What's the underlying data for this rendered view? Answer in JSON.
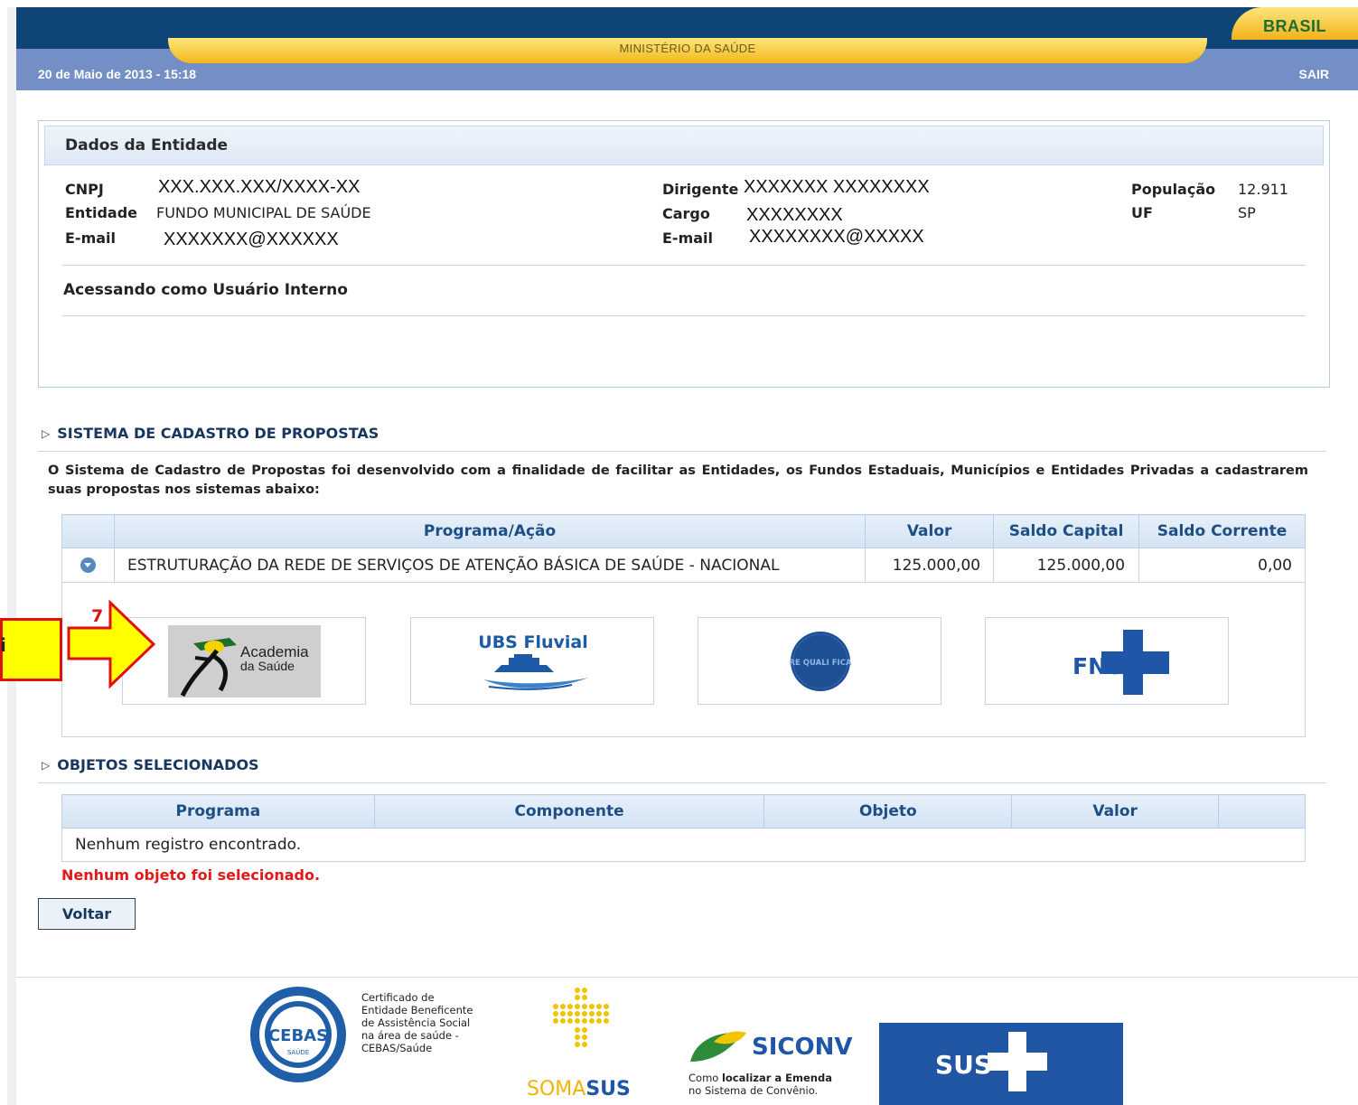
{
  "header": {
    "ministry": "MINISTÉRIO DA SAÚDE",
    "brasil": "BRASIL",
    "date": "20 de Maio de 2013   - 15:18",
    "logout": "SAIR"
  },
  "entity": {
    "title": "Dados da Entidade",
    "cnpj_label": "CNPJ",
    "cnpj": "XXX.XXX.XXX/XXXX-XX",
    "entidade_label": "Entidade",
    "entidade": "FUNDO MUNICIPAL DE SAÚDE",
    "email_label": "E-mail",
    "email": "XXXXXXX@XXXXXX",
    "dirigente_label": "Dirigente",
    "dirigente": "XXXXXXX XXXXXXXX",
    "cargo_label": "Cargo",
    "cargo": "XXXXXXXX",
    "email2_label": "E-mail",
    "email2": "XXXXXXXX@XXXXX",
    "populacao_label": "População",
    "populacao": "12.911",
    "uf_label": "UF",
    "uf": "SP",
    "access": "Acessando como Usuário Interno"
  },
  "propostas": {
    "title": "SISTEMA DE CADASTRO DE PROPOSTAS",
    "description": "O Sistema de Cadastro de Propostas foi desenvolvido com a finalidade de facilitar as Entidades, os Fundos Estaduais, Municípios e Entidades Privadas a cadastrarem suas propostas nos sistemas abaixo:",
    "columns": [
      "Programa/Ação",
      "Valor",
      "Saldo Capital",
      "Saldo Corrente"
    ],
    "rows": [
      {
        "programa": "ESTRUTURAÇÃO DA REDE DE SERVIÇOS DE ATENÇÃO BÁSICA DE SAÚDE - NACIONAL",
        "valor": "125.000,00",
        "saldo_capital": "125.000,00",
        "saldo_corrente": "0,00"
      }
    ],
    "tiles": [
      {
        "name": "Academia da Saúde",
        "line1": "Academia",
        "line2": "da Saúde"
      },
      {
        "name": "UBS Fluvial",
        "label": "UBS Fluvial"
      },
      {
        "name": "Requalifica UBS",
        "label": "RE QUALI FICA"
      },
      {
        "name": "FNS",
        "label": "FNS"
      }
    ]
  },
  "objetos": {
    "title": "OBJETOS SELECIONADOS",
    "columns": [
      "Programa",
      "Componente",
      "Objeto",
      "Valor",
      ""
    ],
    "empty_row": "Nenhum registro encontrado.",
    "empty_msg": "Nenhum objeto foi selecionado."
  },
  "actions": {
    "back": "Voltar"
  },
  "annotation": {
    "text": "i",
    "number": "7"
  },
  "footer": {
    "cebas_badge": "CEBAS",
    "cebas_sub": "SAÚDE",
    "cebas_text": [
      "Certificado de",
      "Entidade Beneficente",
      "de Assistência Social",
      "na área de saúde -",
      "CEBAS/Saúde"
    ],
    "somasus_a": "SOMA",
    "somasus_b": "SUS",
    "siconv": "SICONV",
    "siconv_line1_a": "Como ",
    "siconv_line1_b": "localizar a Emenda",
    "siconv_line2": "no Sistema de Convênio.",
    "sus": "SUS"
  },
  "colors": {
    "navy": "#0f4477",
    "steel": "#738fc6",
    "gold": "#f3b71c",
    "section_blue": "#17375e",
    "header_blue": "#1d4f86",
    "error_red": "#e11919",
    "sus_blue": "#2156a5"
  }
}
